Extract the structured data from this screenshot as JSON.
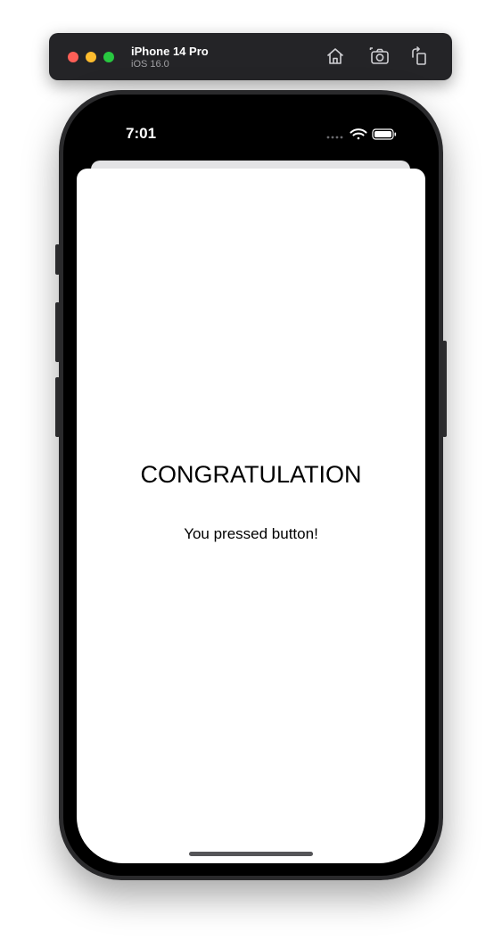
{
  "simulator": {
    "device_name": "iPhone 14 Pro",
    "os_version": "iOS 16.0",
    "toolbar_icons": [
      "home-icon",
      "screenshot-icon",
      "rotate-icon"
    ]
  },
  "status_bar": {
    "time": "7:01",
    "icons": [
      "signal-dots-icon",
      "wifi-icon",
      "battery-icon"
    ]
  },
  "screen": {
    "title": "CONGRATULATION",
    "message": "You pressed button!"
  },
  "colors": {
    "window_close": "#fe5f57",
    "window_minimize": "#febc2e",
    "window_zoom": "#28c840",
    "sheet_background": "#ffffff",
    "phone_frame": "#000000"
  }
}
